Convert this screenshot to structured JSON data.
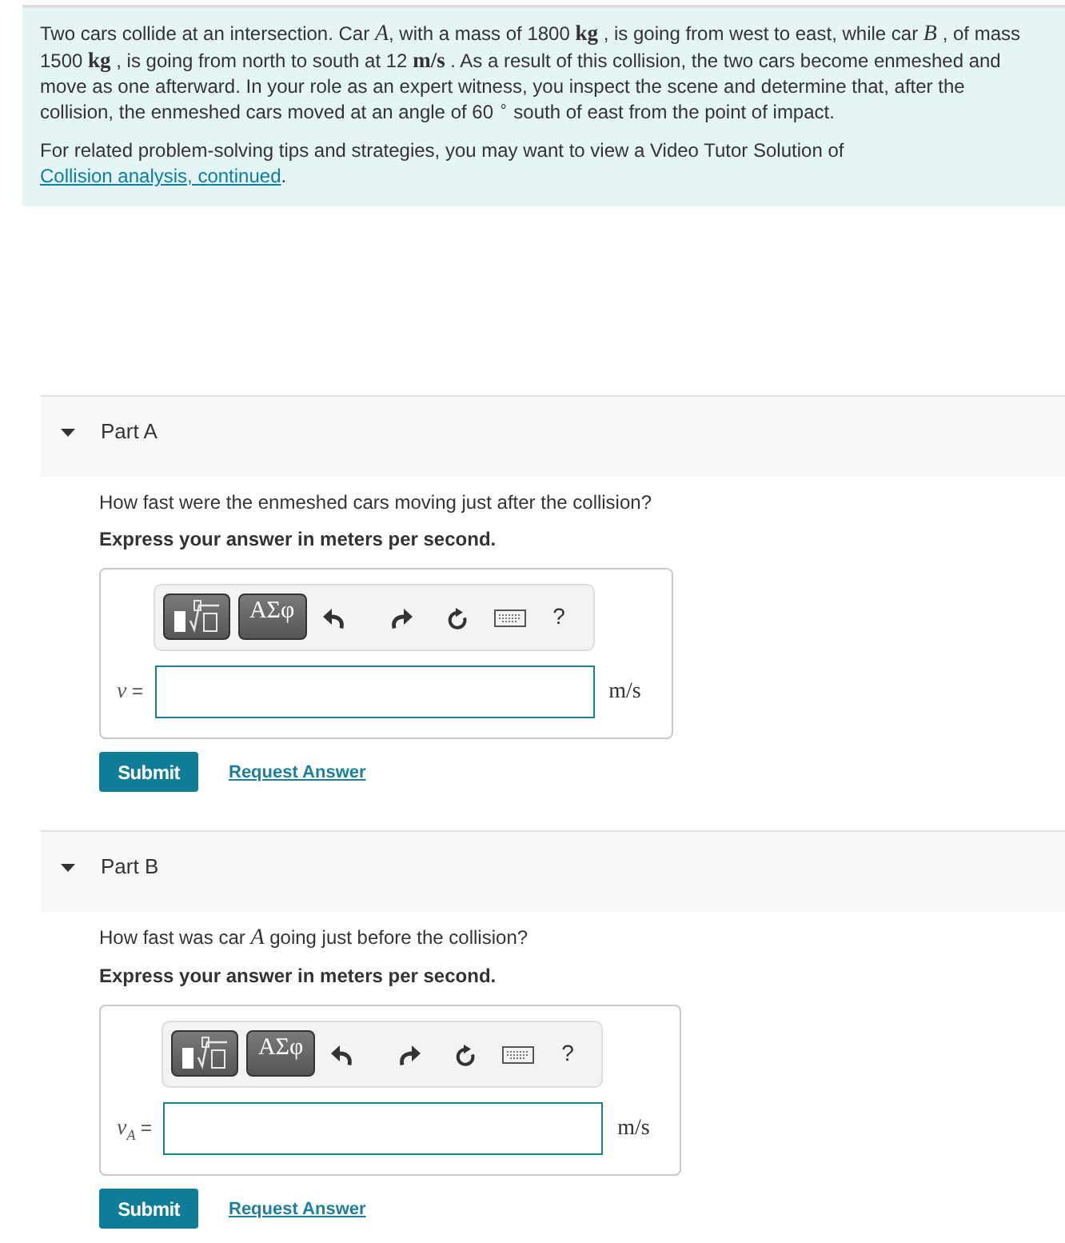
{
  "problem": {
    "statement": "Two cars collide at an intersection. Car *A*, with a mass of 1800 **kg** , is going from west to east, while car *B* , of mass 1500 **kg** , is going from north to south at 12 **m/s** . As a result of this collision, the two cars become enmeshed and move as one afterward. In your role as an expert witness, you inspect the scene and determine that, after the collision, the enmeshed cars moved at an angle of 60 $^{∘}$ south of east from the point of impact.",
    "tutor_text": "For related problem-solving tips and strategies, you may want to view a Video Tutor Solution of",
    "tutor_link": "Collision analysis, continued",
    "tutor_end": "."
  },
  "parts": [
    {
      "title": "Part A",
      "expanded": true,
      "question": "How fast were the enmeshed cars moving just after the collision?",
      "instruction": "Express your answer in meters per second.",
      "toolbar": {
        "greek_button": "ΑΣφ",
        "help_button": "?"
      },
      "variable": "*v* =",
      "unit": "m/s",
      "submit": "Submit",
      "request_answer": "Request Answer"
    },
    {
      "title": "Part B",
      "expanded": true,
      "question": "How fast was car *A* going just before the collision?",
      "instruction": "Express your answer in meters per second.",
      "toolbar": {
        "greek_button": "ΑΣφ",
        "help_button": "?"
      },
      "variable": "*v*$_{A}$ =",
      "unit": "m/s",
      "submit": "Submit",
      "request_answer": "Request Answer"
    }
  ]
}
